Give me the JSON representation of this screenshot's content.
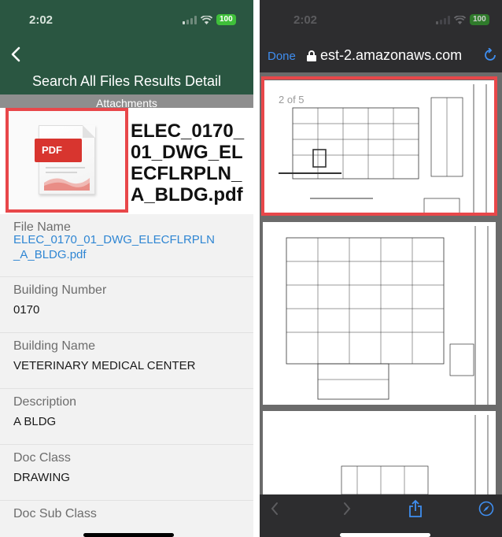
{
  "left_screen": {
    "status": {
      "time": "2:02",
      "battery": "100"
    },
    "header": {
      "back_icon": "chevron-left-icon",
      "title": "Search All Files Results Detail"
    },
    "attachments_label": "Attachments",
    "thumbnail": {
      "badge": "PDF",
      "icon": "pdf-file-icon"
    },
    "file_title": "ELEC_0170_01_DWG_ELECFLRPLN_A_BLDG.pdf",
    "file_title_lines": [
      "ELEC_0170_",
      "01_DWG_EL",
      "ECFLRPLN_",
      "A_BLDG.pdf"
    ],
    "fields": [
      {
        "label": "File Name",
        "value_lines": [
          "ELEC_0170_01_DWG_ELECFLRPLN",
          "_A_BLDG.pdf"
        ],
        "link": true
      },
      {
        "label": "Building Number",
        "value": "0170"
      },
      {
        "label": "Building Name",
        "value": "VETERINARY MEDICAL CENTER"
      },
      {
        "label": "Description",
        "value": "A BLDG"
      },
      {
        "label": "Doc Class",
        "value": "DRAWING"
      },
      {
        "label": "Doc Sub Class",
        "value": ""
      }
    ],
    "colors": {
      "header": "#2a5641",
      "highlight": "#e8474a",
      "link": "#2f86d3",
      "attachments_bar": "#8e8e8e"
    }
  },
  "right_screen": {
    "status": {
      "time": "2:02",
      "battery": "100"
    },
    "toolbar": {
      "done_label": "Done",
      "url": "est-2.amazonaws.com",
      "lock_icon": "lock-icon",
      "reload_icon": "reload-icon"
    },
    "pdf": {
      "page_indicator": "2 of 5",
      "pages_visible": 3
    },
    "bottom_bar": {
      "back_icon": "back-arrow-icon",
      "forward_icon": "forward-arrow-icon",
      "share_icon": "share-icon",
      "compass_icon": "compass-icon"
    },
    "colors": {
      "bar": "#2d2d2f",
      "accent": "#3f8ef0",
      "highlight": "#e8474a"
    }
  }
}
